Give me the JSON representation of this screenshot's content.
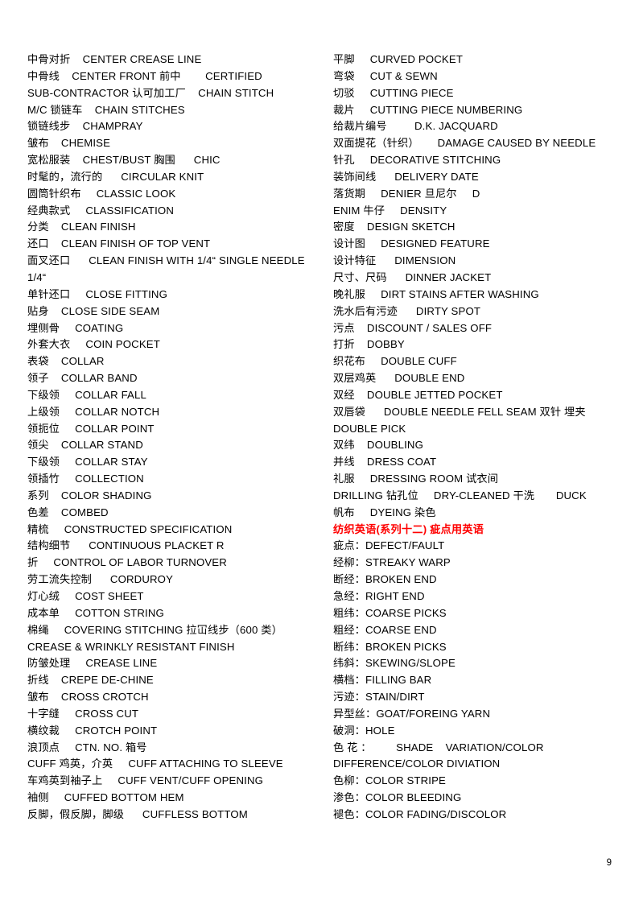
{
  "document": {
    "page_number": "9",
    "accent_color": "#ff0000",
    "text_color": "#000000",
    "background_color": "#ffffff"
  },
  "left_column": {
    "lines": [
      {
        "text": "中骨对折    CENTER CREASE LINE",
        "style": "normal"
      },
      {
        "text": "中骨线    CENTER FRONT 前中        CERTIFIED",
        "style": "normal"
      },
      {
        "text": "SUB-CONTRACTOR 认可加工厂    CHAIN STITCH",
        "style": "normal"
      },
      {
        "text": "M/C 锁链车    CHAIN STITCHES",
        "style": "normal"
      },
      {
        "text": "锁链线步    CHAMPRAY",
        "style": "normal"
      },
      {
        "text": "皱布    CHEMISE",
        "style": "normal"
      },
      {
        "text": "宽松服装    CHEST/BUST 胸围      CHIC",
        "style": "normal"
      },
      {
        "text": "时髦的，流行的      CIRCULAR KNIT",
        "style": "normal"
      },
      {
        "text": "圆筒针织布     CLASSIC LOOK",
        "style": "normal"
      },
      {
        "text": "经典款式     CLASSIFICATION",
        "style": "normal"
      },
      {
        "text": "分类    CLEAN FINISH",
        "style": "normal"
      },
      {
        "text": "还口    CLEAN FINISH OF TOP VENT",
        "style": "normal"
      },
      {
        "text": "面叉还口      CLEAN FINISH WITH 1/4“ SINGLE NEEDLE 1/4“",
        "style": "normal"
      },
      {
        "text": "单针还口     CLOSE FITTING",
        "style": "normal"
      },
      {
        "text": "贴身    CLOSE SIDE SEAM",
        "style": "normal"
      },
      {
        "text": "埋侧骨     COATING",
        "style": "normal"
      },
      {
        "text": "外套大衣     COIN POCKET",
        "style": "normal"
      },
      {
        "text": "表袋    COLLAR",
        "style": "normal"
      },
      {
        "text": "领子    COLLAR BAND",
        "style": "normal"
      },
      {
        "text": "下级领     COLLAR FALL",
        "style": "normal"
      },
      {
        "text": "上级领     COLLAR NOTCH",
        "style": "normal"
      },
      {
        "text": "领扼位     COLLAR POINT",
        "style": "normal"
      },
      {
        "text": "领尖    COLLAR STAND",
        "style": "normal"
      },
      {
        "text": "下级领     COLLAR STAY",
        "style": "normal"
      },
      {
        "text": "领插竹     COLLECTION",
        "style": "normal"
      },
      {
        "text": "系列    COLOR SHADING",
        "style": "normal"
      },
      {
        "text": "色差    COMBED",
        "style": "normal"
      },
      {
        "text": "精梳     CONSTRUCTED SPECIFICATION",
        "style": "normal"
      },
      {
        "text": "结构细节      CONTINUOUS PLACKET R",
        "style": "normal"
      },
      {
        "text": "折     CONTROL OF LABOR TURNOVER",
        "style": "normal"
      },
      {
        "text": "劳工流失控制      CORDUROY",
        "style": "normal"
      },
      {
        "text": "灯心绒     COST SHEET",
        "style": "normal"
      },
      {
        "text": "成本单     COTTON STRING",
        "style": "normal"
      },
      {
        "text": "棉绳     COVERING STITCHING 拉冚线步（600 类）",
        "style": "normal"
      },
      {
        "text": "CREASE & WRINKLY RESISTANT FINISH",
        "style": "normal"
      },
      {
        "text": "防皱处理     CREASE LINE",
        "style": "normal"
      },
      {
        "text": "折线    CREPE DE-CHINE",
        "style": "normal"
      },
      {
        "text": "皱布    CROSS CROTCH",
        "style": "normal"
      },
      {
        "text": "十字缝     CROSS CUT",
        "style": "normal"
      },
      {
        "text": "横纹裁     CROTCH POINT",
        "style": "normal"
      },
      {
        "text": "浪顶点     CTN. NO. 箱号",
        "style": "normal"
      },
      {
        "text": "CUFF 鸡英，介英     CUFF ATTACHING TO SLEEVE",
        "style": "normal"
      },
      {
        "text": "车鸡英到袖子上     CUFF VENT/CUFF OPENING",
        "style": "normal"
      },
      {
        "text": "袖侧     CUFFED BOTTOM HEM",
        "style": "normal"
      },
      {
        "text": "反脚，假反脚，脚级      CUFFLESS BOTTOM",
        "style": "normal"
      }
    ]
  },
  "right_column": {
    "lines": [
      {
        "text": "平脚     CURVED POCKET",
        "style": "normal"
      },
      {
        "text": "弯袋     CUT & SEWN",
        "style": "normal"
      },
      {
        "text": "切驳     CUTTING PIECE",
        "style": "normal"
      },
      {
        "text": "裁片     CUTTING PIECE NUMBERING",
        "style": "normal"
      },
      {
        "text": "给裁片编号         D.K. JACQUARD",
        "style": "normal"
      },
      {
        "text": "双面提花（针织）      DAMAGE CAUSED BY NEEDLE",
        "style": "normal"
      },
      {
        "text": "针孔     DECORATIVE STITCHING",
        "style": "normal"
      },
      {
        "text": "装饰间线      DELIVERY DATE",
        "style": "normal"
      },
      {
        "text": "落货期     DENIER 旦尼尔     D",
        "style": "normal"
      },
      {
        "text": "ENIM 牛仔     DENSITY",
        "style": "normal"
      },
      {
        "text": "密度    DESIGN SKETCH",
        "style": "normal"
      },
      {
        "text": "设计图     DESIGNED FEATURE",
        "style": "normal"
      },
      {
        "text": "设计特征      DIMENSION",
        "style": "normal"
      },
      {
        "text": "尺寸、尺码      DINNER JACKET",
        "style": "normal"
      },
      {
        "text": "晚礼服     DIRT STAINS AFTER WASHING",
        "style": "normal"
      },
      {
        "text": "洗水后有污迹      DIRTY SPOT",
        "style": "normal"
      },
      {
        "text": "污点    DISCOUNT / SALES OFF",
        "style": "normal"
      },
      {
        "text": "打折    DOBBY",
        "style": "normal"
      },
      {
        "text": "织花布     DOUBLE CUFF",
        "style": "normal"
      },
      {
        "text": "双层鸡英      DOUBLE END",
        "style": "normal"
      },
      {
        "text": "双经    DOUBLE JETTED POCKET",
        "style": "normal"
      },
      {
        "text": "双唇袋      DOUBLE NEEDLE FELL SEAM 双针 埋夹 DOUBLE PICK",
        "style": "normal"
      },
      {
        "text": "双纬    DOUBLING",
        "style": "normal"
      },
      {
        "text": "并线    DRESS COAT",
        "style": "normal"
      },
      {
        "text": "礼服     DRESSING ROOM 试衣间",
        "style": "normal"
      },
      {
        "text": "DRILLING 钻孔位     DRY-CLEANED 干洗       DUCK",
        "style": "normal"
      },
      {
        "text": "帆布     DYEING 染色",
        "style": "normal"
      },
      {
        "text": "纺织英语(系列十二) 疵点用英语",
        "style": "heading"
      },
      {
        "text": "疵点：DEFECT/FAULT",
        "style": "normal"
      },
      {
        "text": "经柳：STREAKY WARP",
        "style": "normal"
      },
      {
        "text": "断经：BROKEN END",
        "style": "normal"
      },
      {
        "text": "急经：RIGHT END",
        "style": "normal"
      },
      {
        "text": "粗纬：COARSE PICKS",
        "style": "normal"
      },
      {
        "text": "粗经：COARSE END",
        "style": "normal"
      },
      {
        "text": "断纬：BROKEN PICKS",
        "style": "normal"
      },
      {
        "text": "纬斜：SKEWING/SLOPE",
        "style": "normal"
      },
      {
        "text": "横档：FILLING BAR",
        "style": "normal"
      },
      {
        "text": "污迹：STAIN/DIRT",
        "style": "normal"
      },
      {
        "text": "异型丝：GOAT/FOREING YARN",
        "style": "normal"
      },
      {
        "text": "破洞：HOLE",
        "style": "normal"
      },
      {
        "text": "色 花 ：        SHADE    VARIATION/COLOR DIFFERENCE/COLOR DIVIATION",
        "style": "normal"
      },
      {
        "text": "色柳：COLOR STRIPE",
        "style": "normal"
      },
      {
        "text": "渗色：COLOR BLEEDING",
        "style": "normal"
      },
      {
        "text": "褪色：COLOR FADING/DISCOLOR",
        "style": "normal"
      }
    ]
  }
}
